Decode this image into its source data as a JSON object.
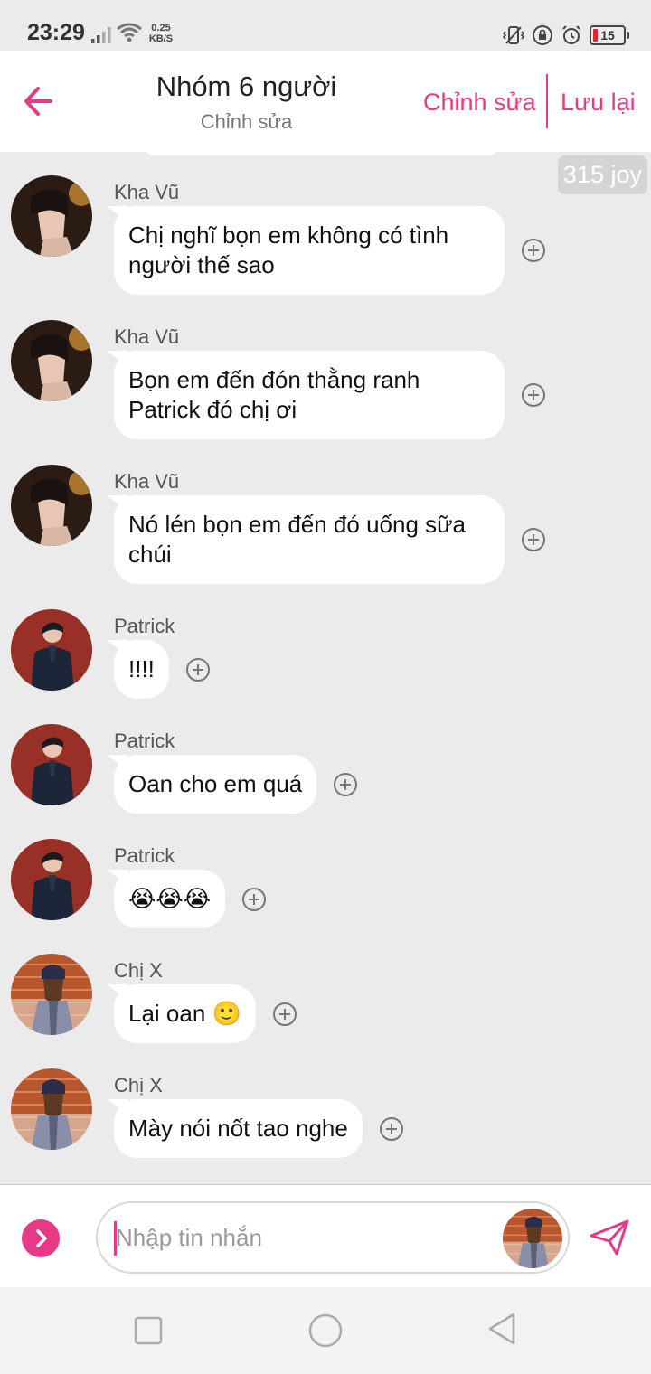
{
  "status_bar": {
    "time": "23:29",
    "net_speed_value": "0.25",
    "net_speed_unit": "KB/S",
    "battery": "15"
  },
  "header": {
    "title": "Nhóm 6 người",
    "subtitle": "Chỉnh sửa",
    "edit_label": "Chỉnh sửa",
    "save_label": "Lưu lại",
    "accent_color": "#e63a86"
  },
  "joy_badge": "315 joy",
  "messages": [
    {
      "sender": "Kha Vũ",
      "avatar": "kha-vu-avatar",
      "lines": [
        "Chị nghĩ bọn em không có tình",
        "người thế sao"
      ]
    },
    {
      "sender": "Kha Vũ",
      "avatar": "kha-vu-avatar",
      "lines": [
        "Bọn em đến đón thằng ranh",
        "Patrick đó chị ơi"
      ]
    },
    {
      "sender": "Kha Vũ",
      "avatar": "kha-vu-avatar",
      "lines": [
        "Nó lén bọn em đến đó uống sữa",
        "chúi"
      ]
    },
    {
      "sender": "Patrick",
      "avatar": "patrick-avatar",
      "lines": [
        "!!!!"
      ]
    },
    {
      "sender": "Patrick",
      "avatar": "patrick-avatar",
      "lines": [
        "Oan cho em quá"
      ]
    },
    {
      "sender": "Patrick",
      "avatar": "patrick-avatar",
      "lines": [
        "😭😭😭"
      ]
    },
    {
      "sender": "Chị X",
      "avatar": "chi-x-avatar",
      "lines": [
        "Lại oan 🙂"
      ]
    },
    {
      "sender": "Chị X",
      "avatar": "chi-x-avatar",
      "lines": [
        "Mày nói nốt tao nghe"
      ]
    }
  ],
  "input": {
    "placeholder": "Nhập tin nhắn",
    "value": ""
  }
}
